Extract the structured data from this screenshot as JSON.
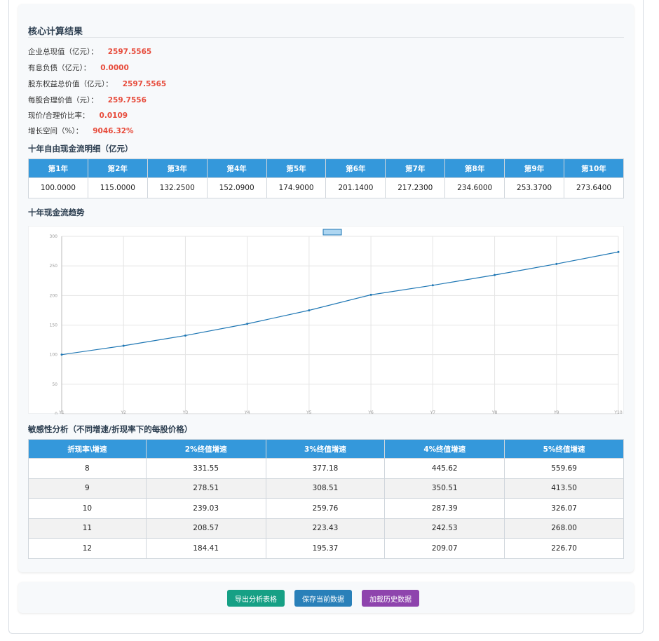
{
  "core": {
    "title": "核心计算结果",
    "metrics": [
      {
        "label": "企业总现值（亿元）：",
        "value": "2597.5565"
      },
      {
        "label": "有息负债（亿元）：",
        "value": "0.0000"
      },
      {
        "label": "股东权益总价值（亿元）：",
        "value": "2597.5565"
      },
      {
        "label": "每股合理价值（元）：",
        "value": "259.7556"
      },
      {
        "label": "现价/合理价比率：",
        "value": "0.0109"
      },
      {
        "label": "增长空间（%）：",
        "value": "9046.32%"
      }
    ]
  },
  "fcf_table": {
    "title": "十年自由现金流明细（亿元）",
    "headers": [
      "第1年",
      "第2年",
      "第3年",
      "第4年",
      "第5年",
      "第6年",
      "第7年",
      "第8年",
      "第9年",
      "第10年"
    ],
    "values": [
      "100.0000",
      "115.0000",
      "132.2500",
      "152.0900",
      "174.9000",
      "201.1400",
      "217.2300",
      "234.6000",
      "253.3700",
      "273.6400"
    ]
  },
  "trend": {
    "title": "十年现金流趋势"
  },
  "chart_data": {
    "type": "line",
    "title": "",
    "legend_position": "top-center",
    "grid": true,
    "x": [
      "Y1",
      "Y2",
      "Y3",
      "Y4",
      "Y5",
      "Y6",
      "Y7",
      "Y8",
      "Y9",
      "Y10"
    ],
    "ylim": [
      0,
      300
    ],
    "yticks": [
      0,
      50,
      100,
      150,
      200,
      250,
      300
    ],
    "series": [
      {
        "values": [
          100.0,
          115.0,
          132.25,
          152.09,
          174.9,
          201.14,
          217.23,
          234.6,
          253.37,
          273.64
        ]
      }
    ],
    "colors": {
      "line": "#1f77b4",
      "legend_fill": "#aed6f1",
      "grid": "#e5e5e5"
    }
  },
  "sensitivity": {
    "title": "敏感性分析（不同增速/折现率下的每股价格）",
    "headers": [
      "折现率\\增速",
      "2%终值增速",
      "3%终值增速",
      "4%终值增速",
      "5%终值增速"
    ],
    "rows": [
      [
        "8",
        "331.55",
        "377.18",
        "445.62",
        "559.69"
      ],
      [
        "9",
        "278.51",
        "308.51",
        "350.51",
        "413.50"
      ],
      [
        "10",
        "239.03",
        "259.76",
        "287.39",
        "326.07"
      ],
      [
        "11",
        "208.57",
        "223.43",
        "242.53",
        "268.00"
      ],
      [
        "12",
        "184.41",
        "195.37",
        "209.07",
        "226.70"
      ]
    ]
  },
  "buttons": {
    "export": "导出分析表格",
    "save": "保存当前数据",
    "load": "加载历史数据"
  },
  "colors": {
    "header_blue": "#3498db",
    "value_red": "#e74c3c",
    "export": "#16a085",
    "save": "#2980b9",
    "load": "#8e44ad"
  }
}
